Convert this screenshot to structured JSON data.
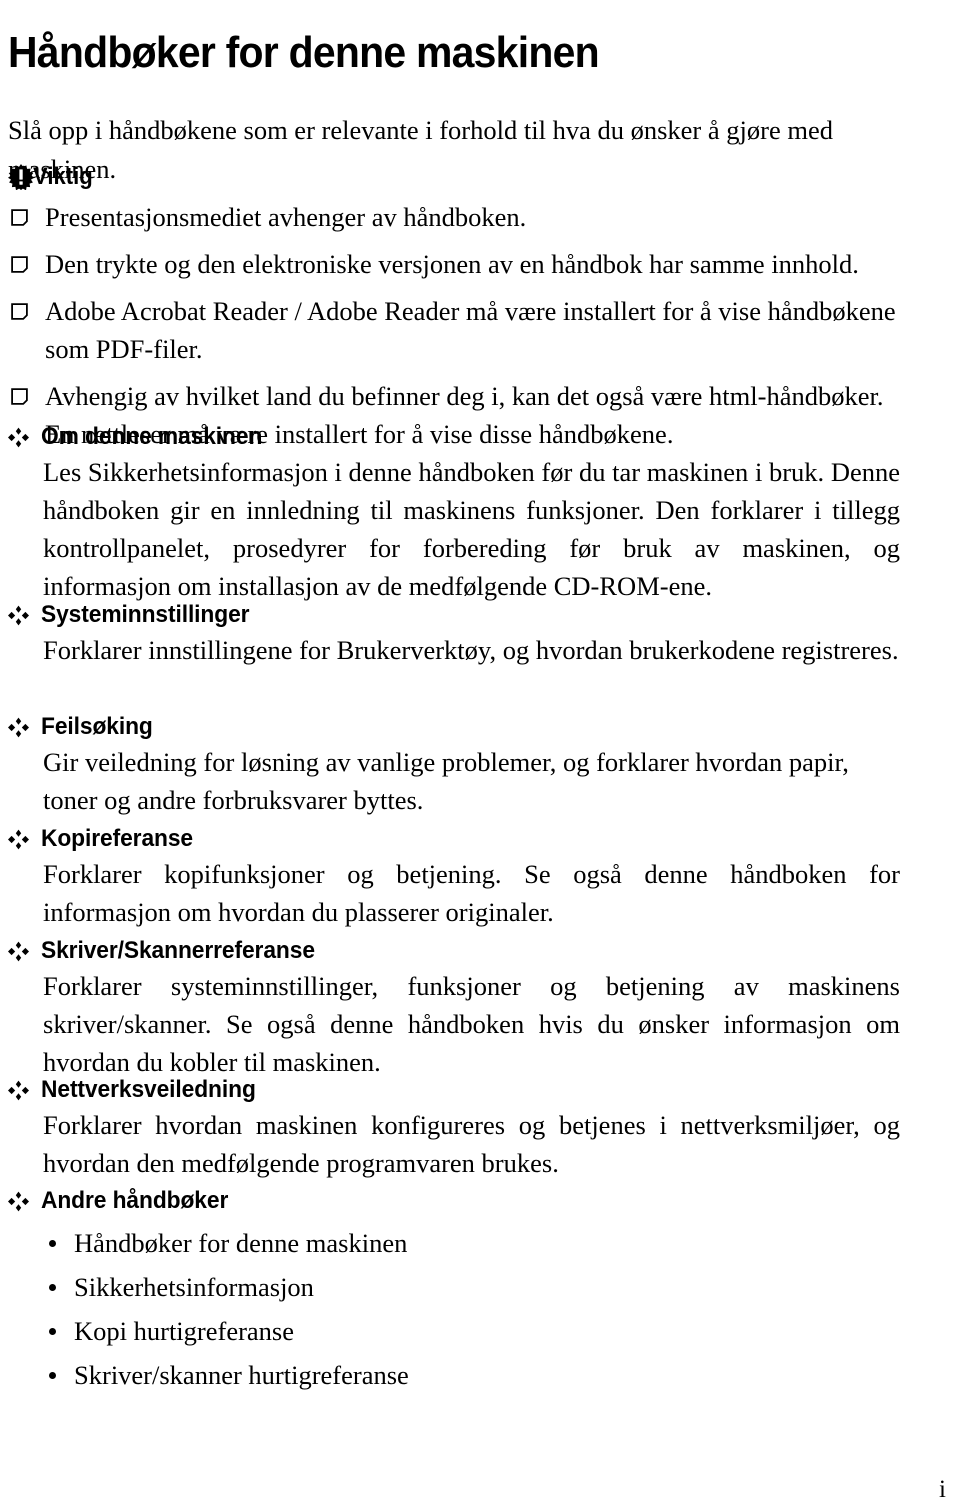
{
  "document": {
    "title": "Håndbøker for denne maskinen",
    "intro": "Slå opp i håndbøkene som er relevante i forhold til hva du ønsker å gjøre med maskinen.",
    "page_number": "i"
  },
  "important_note": {
    "icon": "important-burst-icon",
    "label": "Viktig",
    "items": [
      "Presentasjonsmediet avhenger av håndboken.",
      "Den trykte og den elektroniske versjonen av en håndbok har samme innhold.",
      "Adobe Acrobat Reader / Adobe Reader må være installert for å vise håndbøkene som PDF-filer.",
      "Avhengig av hvilket land du befinner deg i, kan det også være html-håndbøker. En nettleser må være installert for å vise disse håndbøkene."
    ]
  },
  "sections": [
    {
      "marker": "floret-icon",
      "heading": "Om denne maskinen",
      "body": "Les Sikkerhetsinformasjon i denne håndboken før du tar maskinen i bruk. Denne håndboken gir en innledning til maskinens funksjoner. Den forklarer i tillegg kontrollpanelet, prosedyrer for forbereding før bruk av maskinen, og informasjon om installasjon av de medfølgende CD-ROM-ene."
    },
    {
      "marker": "floret-icon",
      "heading": "Systeminnstillinger",
      "body": "Forklarer innstillingene for Brukerverktøy, og hvordan brukerkodene registreres."
    },
    {
      "marker": "floret-icon",
      "heading": "Feilsøking",
      "body": "Gir veiledning for løsning av vanlige problemer, og forklarer hvordan papir, toner og andre forbruksvarer byttes."
    },
    {
      "marker": "floret-icon",
      "heading": "Kopireferanse",
      "body": "Forklarer kopifunksjoner og betjening. Se også denne håndboken for informasjon om hvordan du plasserer originaler."
    },
    {
      "marker": "floret-icon",
      "heading": "Skriver/Skannerreferanse",
      "body": "Forklarer systeminnstillinger, funksjoner og betjening av maskinens skriver/skanner. Se også denne håndboken hvis du ønsker informasjon om hvordan du kobler til maskinen."
    },
    {
      "marker": "floret-icon",
      "heading": "Nettverksveiledning",
      "body": "Forklarer hvordan maskinen konfigureres og betjenes i nettverksmiljøer, og hvordan den medfølgende programvaren brukes."
    },
    {
      "marker": "floret-icon",
      "heading": "Andre håndbøker",
      "body": "",
      "sub_items": [
        "Håndbøker for denne maskinen",
        "Sikkerhetsinformasjon",
        "Kopi hurtigreferanse",
        "Skriver/skanner hurtigreferanse"
      ]
    }
  ],
  "colors": {
    "text": "#000000",
    "background": "#ffffff"
  }
}
